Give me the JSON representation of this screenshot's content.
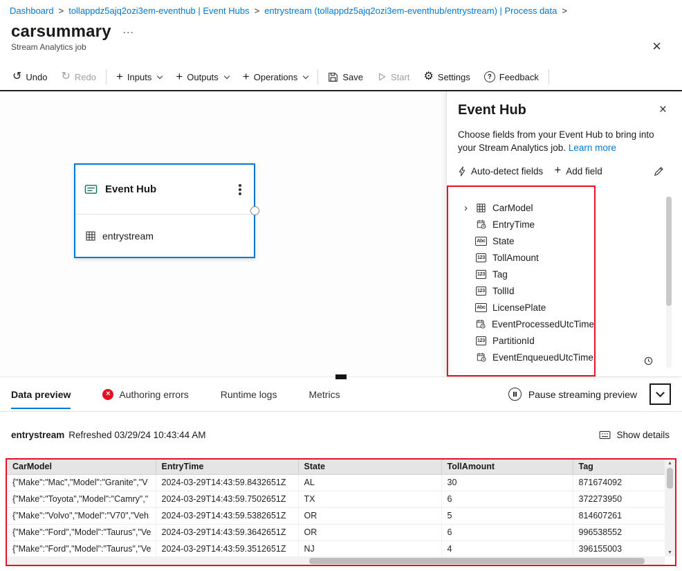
{
  "colors": {
    "accent": "#0078d4",
    "annotation_red": "#e81123",
    "error_red": "#e81123"
  },
  "icons": {
    "separator": ">",
    "more": "…",
    "close": "×",
    "undo": "↺",
    "redo": "↻",
    "plus": "+",
    "gear": "⚙",
    "question": "?",
    "error_x": "×",
    "expander": "›",
    "string_glyph": "Abc",
    "number_glyph": "123",
    "scroll_up": "▲",
    "scroll_down": "▼"
  },
  "breadcrumb": {
    "items": [
      {
        "label": "Dashboard"
      },
      {
        "label": "tollappdz5ajq2ozi3em-eventhub | Event Hubs"
      },
      {
        "label": "entrystream (tollappdz5ajq2ozi3em-eventhub/entrystream) | Process data"
      }
    ]
  },
  "header": {
    "title": "carsummary",
    "subtitle": "Stream Analytics job"
  },
  "toolbar": {
    "undo": "Undo",
    "redo": "Redo",
    "inputs": "Inputs",
    "outputs": "Outputs",
    "operations": "Operations",
    "save": "Save",
    "start": "Start",
    "settings": "Settings",
    "feedback": "Feedback"
  },
  "canvas": {
    "node": {
      "title": "Event Hub",
      "subtitle": "entrystream"
    }
  },
  "panel": {
    "title": "Event Hub",
    "description": "Choose fields from your Event Hub to bring into your Stream Analytics job.",
    "learn_more": "Learn more",
    "auto_detect": "Auto-detect fields",
    "add_field": "Add field",
    "fields": [
      {
        "name": "CarModel",
        "type": "record"
      },
      {
        "name": "EntryTime",
        "type": "datetime"
      },
      {
        "name": "State",
        "type": "string"
      },
      {
        "name": "TollAmount",
        "type": "number"
      },
      {
        "name": "Tag",
        "type": "number"
      },
      {
        "name": "TollId",
        "type": "number"
      },
      {
        "name": "LicensePlate",
        "type": "string"
      },
      {
        "name": "EventProcessedUtcTime",
        "type": "datetime"
      },
      {
        "name": "PartitionId",
        "type": "number"
      },
      {
        "name": "EventEnqueuedUtcTime",
        "type": "datetime"
      }
    ]
  },
  "tabs": {
    "data_preview": "Data preview",
    "authoring_errors": "Authoring errors",
    "runtime_logs": "Runtime logs",
    "metrics": "Metrics",
    "pause": "Pause streaming preview"
  },
  "preview": {
    "stream_name": "entrystream",
    "refreshed": "Refreshed 03/29/24 10:43:44 AM",
    "show_details": "Show details",
    "table": {
      "columns": [
        "CarModel",
        "EntryTime",
        "State",
        "TollAmount",
        "Tag"
      ],
      "rows": [
        [
          "{\"Make\":\"Mac\",\"Model\":\"Granite\",\"V",
          "2024-03-29T14:43:59.8432651Z",
          "AL",
          "30",
          "871674092"
        ],
        [
          "{\"Make\":\"Toyota\",\"Model\":\"Camry\",\"",
          "2024-03-29T14:43:59.7502651Z",
          "TX",
          "6",
          "372273950"
        ],
        [
          "{\"Make\":\"Volvo\",\"Model\":\"V70\",\"Veh",
          "2024-03-29T14:43:59.5382651Z",
          "OR",
          "5",
          "814607261"
        ],
        [
          "{\"Make\":\"Ford\",\"Model\":\"Taurus\",\"Ve",
          "2024-03-29T14:43:59.3642651Z",
          "OR",
          "6",
          "996538552"
        ],
        [
          "{\"Make\":\"Ford\",\"Model\":\"Taurus\",\"Ve",
          "2024-03-29T14:43:59.3512651Z",
          "NJ",
          "4",
          "396155003"
        ]
      ]
    }
  }
}
